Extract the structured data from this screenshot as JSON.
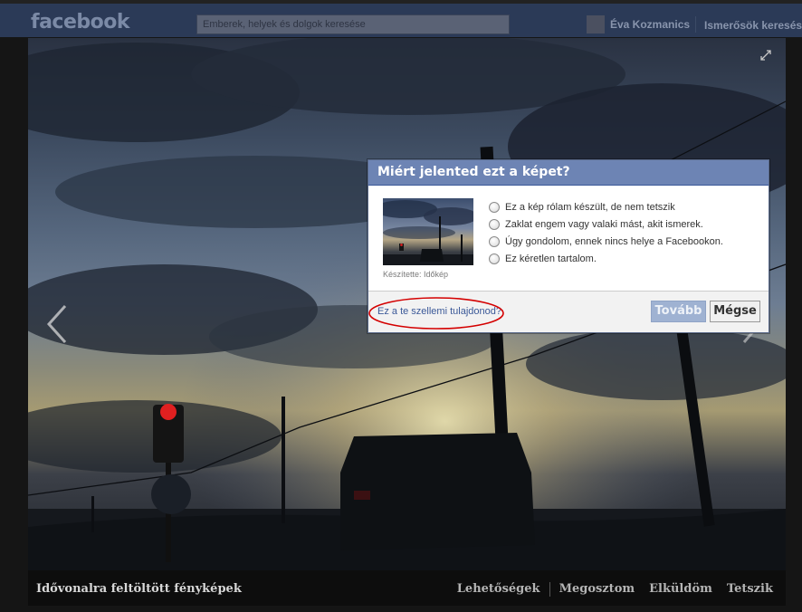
{
  "topbar": {
    "logo": "facebook",
    "search_placeholder": "Emberek, helyek és dolgok keresése",
    "profile_name": "Éva Kozmanics",
    "friends_link": "Ismerősök keresése"
  },
  "photo_viewer": {
    "album_title": "Idővonalra feltöltött fényképek",
    "actions": [
      "Lehetőségek",
      "Megosztom",
      "Elküldöm",
      "Tetszik"
    ]
  },
  "report_dialog": {
    "title": "Miért jelented ezt a képet?",
    "thumbnail_caption": "Készítette: Időkép",
    "options": [
      "Ez a kép rólam készült, de nem tetszik",
      "Zaklat engem vagy valaki mást, akit ismerek.",
      "Úgy gondolom, ennek nincs helye a Facebookon.",
      "Ez kéretlen tartalom."
    ],
    "ip_link": "Ez a te szellemi tulajdonod?",
    "continue_button": "Tovább",
    "cancel_button": "Mégse"
  },
  "colors": {
    "dialog_header": "#6d84b4",
    "link": "#3b5998",
    "annotation_circle": "#d40000"
  }
}
